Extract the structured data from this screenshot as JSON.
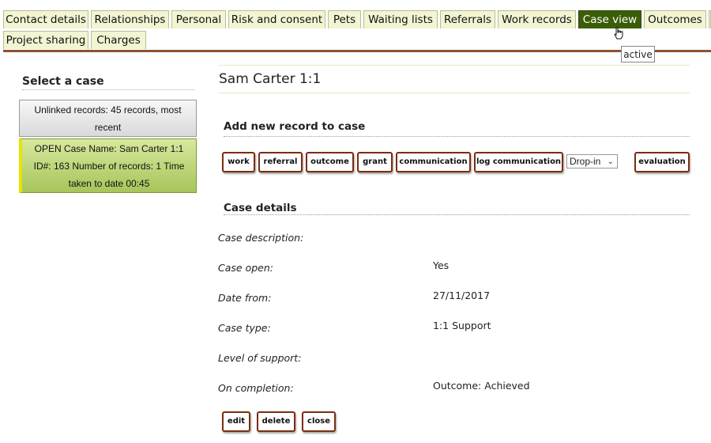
{
  "tabs": {
    "row1": [
      "Contact details",
      "Relationships",
      "Personal",
      "Risk and consent",
      "Pets",
      "Waiting lists",
      "Referrals",
      "Work records",
      "Case view",
      "Outcomes"
    ],
    "row2": [
      "Project sharing",
      "Charges"
    ],
    "active": "Case view"
  },
  "tooltip": "active",
  "left_panel": {
    "title": "Select a case",
    "cases": [
      {
        "text": "Unlinked records: 45 records, most recent"
      },
      {
        "text": "OPEN Case Name: Sam Carter 1:1 ID#: 163 Number of records: 1 Time taken to date 00:45"
      }
    ]
  },
  "main": {
    "title": "Sam Carter 1:1",
    "add_section_title": "Add new record to case",
    "add_buttons": [
      "work",
      "referral",
      "outcome",
      "grant",
      "communication",
      "log communication"
    ],
    "dropdown_value": "Drop-in",
    "evaluation_label": "evaluation",
    "details_section_title": "Case details",
    "details": [
      {
        "label": "Case description:",
        "value": ""
      },
      {
        "label": "Case open:",
        "value": "Yes"
      },
      {
        "label": "Date from:",
        "value": "27/11/2017"
      },
      {
        "label": "Case type:",
        "value": "1:1 Support"
      },
      {
        "label": "Level of support:",
        "value": ""
      },
      {
        "label": "On completion:",
        "value": "Outcome: Achieved"
      }
    ],
    "action_buttons": [
      "edit",
      "delete",
      "close"
    ]
  },
  "colors": {
    "active_tab": "#3b5d08",
    "tab_bg": "#f2f4d2",
    "accent_bar": "#8a5430",
    "open_case": "#a6c55a",
    "button_border": "#7a2e12"
  }
}
